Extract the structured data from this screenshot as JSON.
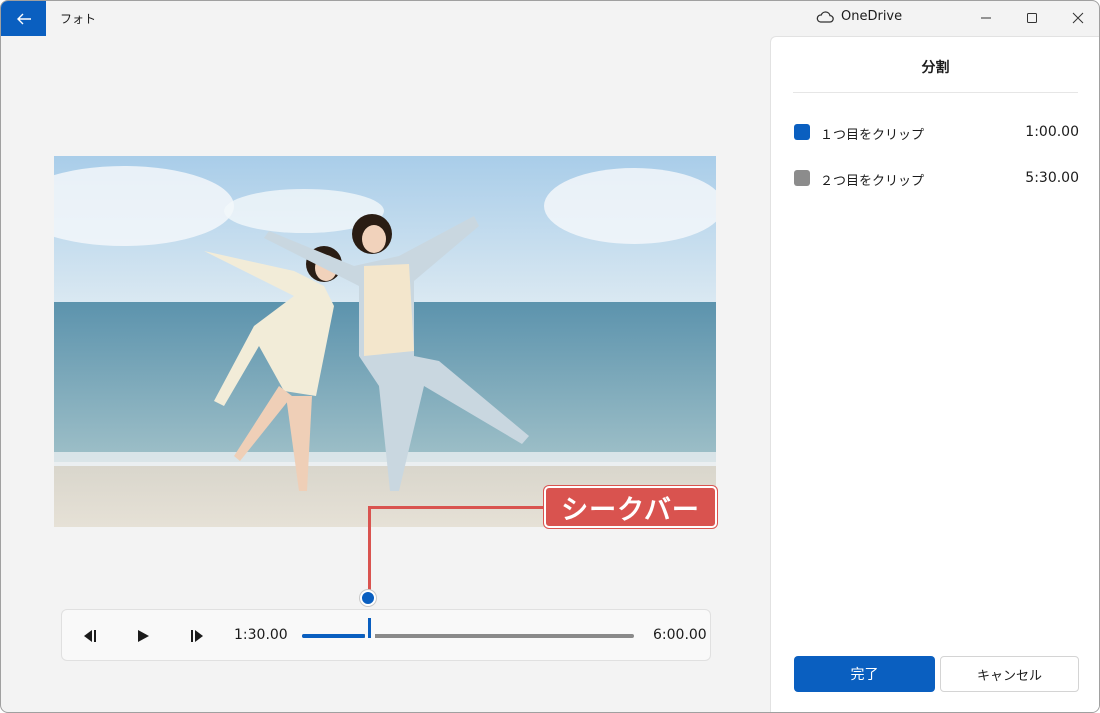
{
  "titlebar": {
    "app_name": "フォト",
    "onedrive_label": "OneDrive"
  },
  "callout": {
    "label": "シークバー"
  },
  "player": {
    "current_time": "1:30.00",
    "total_time": "6:00.00",
    "progress": 0.25
  },
  "panel": {
    "title": "分割",
    "clips": [
      {
        "label": "１つ目をクリップ",
        "time": "1:00.00",
        "color": "#0a5fc0"
      },
      {
        "label": "２つ目をクリップ",
        "time": "5:30.00",
        "color": "#8c8c8c"
      }
    ],
    "done_label": "完了",
    "cancel_label": "キャンセル"
  },
  "colors": {
    "accent": "#0a5fc0",
    "callout": "#d9534f"
  }
}
